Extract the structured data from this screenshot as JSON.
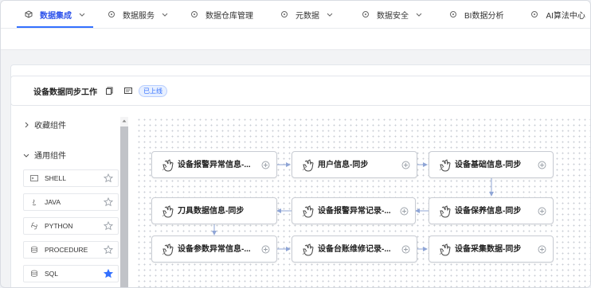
{
  "nav": {
    "tabs": [
      {
        "label": "数据集成",
        "icon": "cube-icon",
        "has_dropdown": true,
        "active": true
      },
      {
        "label": "数据服务",
        "icon": "cloud-icon",
        "has_dropdown": true,
        "active": false
      },
      {
        "label": "数据仓库管理",
        "icon": "database-icon",
        "has_dropdown": false,
        "active": false
      },
      {
        "label": "元数据",
        "icon": "tag-icon",
        "has_dropdown": true,
        "active": false
      },
      {
        "label": "数据安全",
        "icon": "shield-icon",
        "has_dropdown": true,
        "active": false
      },
      {
        "label": "BI数据分析",
        "icon": "chart-icon",
        "has_dropdown": false,
        "active": false
      },
      {
        "label": "AI算法中心",
        "icon": "ai-icon",
        "has_dropdown": false,
        "active": false
      }
    ]
  },
  "job": {
    "title": "设备数据同步工作",
    "status_badge": "已上线"
  },
  "sidebar": {
    "groups": [
      {
        "label": "收藏组件",
        "expanded": false
      },
      {
        "label": "通用组件",
        "expanded": true
      }
    ],
    "components": [
      {
        "label": "SHELL",
        "icon": "terminal-icon",
        "starred": false
      },
      {
        "label": "JAVA",
        "icon": "java-icon",
        "starred": false
      },
      {
        "label": "PYTHON",
        "icon": "python-icon",
        "starred": false
      },
      {
        "label": "PROCEDURE",
        "icon": "procedure-icon",
        "starred": false
      },
      {
        "label": "SQL",
        "icon": "sql-icon",
        "starred": true
      }
    ]
  },
  "flow": {
    "nodes": [
      {
        "id": "n1",
        "label": "设备报警异常信息-..."
      },
      {
        "id": "n2",
        "label": "用户信息-同步"
      },
      {
        "id": "n3",
        "label": "设备基础信息-同步"
      },
      {
        "id": "n4",
        "label": "刀具数据信息-同步"
      },
      {
        "id": "n5",
        "label": "设备报警异常记录-..."
      },
      {
        "id": "n6",
        "label": "设备保养信息-同步"
      },
      {
        "id": "n7",
        "label": "设备参数异常信息-..."
      },
      {
        "id": "n8",
        "label": "设备台账维修记录-..."
      },
      {
        "id": "n9",
        "label": "设备采集数据-同步"
      }
    ],
    "edges": [
      [
        "n1",
        "n2"
      ],
      [
        "n2",
        "n3"
      ],
      [
        "n3",
        "n6"
      ],
      [
        "n6",
        "n5"
      ],
      [
        "n5",
        "n4"
      ],
      [
        "n4",
        "n7"
      ],
      [
        "n7",
        "n8"
      ],
      [
        "n8",
        "n9"
      ]
    ]
  },
  "colors": {
    "accent": "#3370ff",
    "star_active": "#3370ff",
    "edge": "#8fa5d6"
  }
}
